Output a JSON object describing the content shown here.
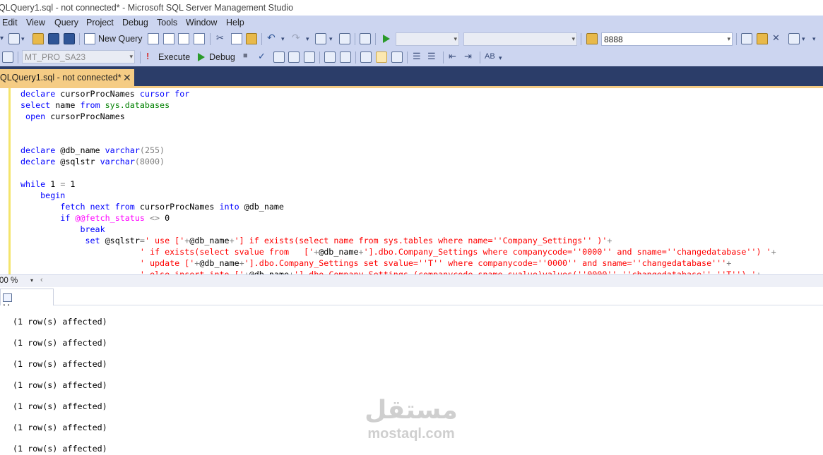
{
  "window": {
    "title": "QLQuery1.sql - not connected* - Microsoft SQL Server Management Studio"
  },
  "menu": [
    "Edit",
    "View",
    "Query",
    "Project",
    "Debug",
    "Tools",
    "Window",
    "Help"
  ],
  "toolbar1": {
    "new_query_label": "New Query",
    "database_combo": "",
    "second_combo": "",
    "find_value": "8888"
  },
  "toolbar2": {
    "server_combo": "MT_PRO_SA23",
    "execute_label": "Execute",
    "debug_label": "Debug"
  },
  "doc_tab": {
    "label": "QLQuery1.sql - not connected*",
    "close": "✕"
  },
  "editor": {
    "zoom": "00 %",
    "lines": [
      [
        {
          "t": "declare ",
          "c": "kw"
        },
        {
          "t": "cursorProcNames ",
          "c": ""
        },
        {
          "t": "cursor ",
          "c": "kw"
        },
        {
          "t": "for",
          "c": "kw"
        }
      ],
      [
        {
          "t": "select ",
          "c": "kw"
        },
        {
          "t": "name ",
          "c": ""
        },
        {
          "t": "from ",
          "c": "kw"
        },
        {
          "t": "sys.databases",
          "c": "sys"
        }
      ],
      [
        {
          "t": " open ",
          "c": "kw"
        },
        {
          "t": "cursorProcNames",
          "c": ""
        }
      ],
      [],
      [],
      [
        {
          "t": "declare ",
          "c": "kw"
        },
        {
          "t": "@db_name ",
          "c": ""
        },
        {
          "t": "varchar",
          "c": "kw"
        },
        {
          "t": "(255)",
          "c": "gr"
        }
      ],
      [
        {
          "t": "declare ",
          "c": "kw"
        },
        {
          "t": "@sqlstr ",
          "c": ""
        },
        {
          "t": "varchar",
          "c": "kw"
        },
        {
          "t": "(8000)",
          "c": "gr"
        }
      ],
      [],
      [
        {
          "t": "while ",
          "c": "kw"
        },
        {
          "t": "1 ",
          "c": ""
        },
        {
          "t": "= ",
          "c": "gr"
        },
        {
          "t": "1",
          "c": ""
        }
      ],
      [
        {
          "t": "    begin",
          "c": "kw"
        }
      ],
      [
        {
          "t": "        fetch next from ",
          "c": "kw"
        },
        {
          "t": "cursorProcNames ",
          "c": ""
        },
        {
          "t": "into ",
          "c": "kw"
        },
        {
          "t": "@db_name",
          "c": ""
        }
      ],
      [
        {
          "t": "        if ",
          "c": "kw"
        },
        {
          "t": "@@fetch_status ",
          "c": "fn"
        },
        {
          "t": "<> ",
          "c": "gr"
        },
        {
          "t": "0",
          "c": ""
        }
      ],
      [
        {
          "t": "            break",
          "c": "kw"
        }
      ],
      [
        {
          "t": "             set ",
          "c": "kw"
        },
        {
          "t": "@sqlstr",
          "c": ""
        },
        {
          "t": "=",
          "c": "gr"
        },
        {
          "t": "' use ['",
          "c": "str"
        },
        {
          "t": "+",
          "c": "gr"
        },
        {
          "t": "@db_name",
          "c": ""
        },
        {
          "t": "+",
          "c": "gr"
        },
        {
          "t": "'] if exists(select name from sys.tables where name=''Company_Settings'' )'",
          "c": "str"
        },
        {
          "t": "+",
          "c": "gr"
        }
      ],
      [
        {
          "t": "                        ",
          "c": ""
        },
        {
          "t": "' if exists(select svalue from   ['",
          "c": "str"
        },
        {
          "t": "+",
          "c": "gr"
        },
        {
          "t": "@db_name",
          "c": ""
        },
        {
          "t": "+",
          "c": "gr"
        },
        {
          "t": "'].dbo.Company_Settings where companycode=''0000'' and sname=''changedatabase'') '",
          "c": "str"
        },
        {
          "t": "+",
          "c": "gr"
        }
      ],
      [
        {
          "t": "                        ",
          "c": ""
        },
        {
          "t": "' update ['",
          "c": "str"
        },
        {
          "t": "+",
          "c": "gr"
        },
        {
          "t": "@db_name",
          "c": ""
        },
        {
          "t": "+",
          "c": "gr"
        },
        {
          "t": "'].dbo.Company_Settings set svalue=''T'' where companycode=''0000'' and sname=''changedatabase'''",
          "c": "str"
        },
        {
          "t": "+",
          "c": "gr"
        }
      ],
      [
        {
          "t": "                        ",
          "c": ""
        },
        {
          "t": "' else insert into ['",
          "c": "str"
        },
        {
          "t": "+",
          "c": "gr"
        },
        {
          "t": "@db_name",
          "c": ""
        },
        {
          "t": "+",
          "c": "gr"
        },
        {
          "t": "'].dbo.Company_Settings (companycode,sname,svalue)values(''0000'',''changedatabase'',''T'') '",
          "c": "str"
        },
        {
          "t": "+",
          "c": "gr"
        }
      ]
    ]
  },
  "results": {
    "tab_label": "Messages",
    "messages": [
      "(1 row(s) affected)",
      "(1 row(s) affected)",
      "(1 row(s) affected)",
      "(1 row(s) affected)",
      "(1 row(s) affected)",
      "(1 row(s) affected)",
      "(1 row(s) affected)"
    ]
  },
  "watermark": {
    "arabic": "مستقل",
    "latin": "mostaql.com"
  }
}
